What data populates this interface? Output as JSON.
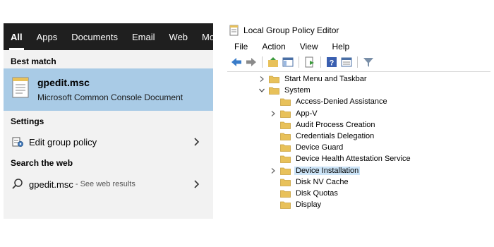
{
  "search": {
    "tabs": [
      {
        "label": "All",
        "active": true
      },
      {
        "label": "Apps"
      },
      {
        "label": "Documents"
      },
      {
        "label": "Email"
      },
      {
        "label": "Web"
      },
      {
        "label": "More"
      }
    ],
    "best_match_heading": "Best match",
    "best_match": {
      "title": "gpedit.msc",
      "subtitle": "Microsoft Common Console Document"
    },
    "settings_heading": "Settings",
    "settings_item": {
      "label": "Edit group policy"
    },
    "web_heading": "Search the web",
    "web_item": {
      "label": "gpedit.msc",
      "hint": " - See web results"
    }
  },
  "gpe": {
    "title": "Local Group Policy Editor",
    "menu": [
      "File",
      "Action",
      "View",
      "Help"
    ],
    "tree": [
      {
        "label": "Start Menu and Taskbar",
        "expander": "collapsed",
        "level": 0
      },
      {
        "label": "System",
        "expander": "expanded",
        "level": 0
      },
      {
        "label": "Access-Denied Assistance",
        "expander": "none",
        "level": 1
      },
      {
        "label": "App-V",
        "expander": "collapsed",
        "level": 1
      },
      {
        "label": "Audit Process Creation",
        "expander": "none",
        "level": 1
      },
      {
        "label": "Credentials Delegation",
        "expander": "none",
        "level": 1
      },
      {
        "label": "Device Guard",
        "expander": "none",
        "level": 1
      },
      {
        "label": "Device Health Attestation Service",
        "expander": "none",
        "level": 1
      },
      {
        "label": "Device Installation",
        "expander": "collapsed",
        "level": 1,
        "selected": true
      },
      {
        "label": "Disk NV Cache",
        "expander": "none",
        "level": 1
      },
      {
        "label": "Disk Quotas",
        "expander": "none",
        "level": 1
      },
      {
        "label": "Display",
        "expander": "none",
        "level": 1
      }
    ]
  },
  "colors": {
    "accent_selected": "#a9cbe6",
    "tree_selected": "#cce4f7",
    "folder": "#e8c15a",
    "tabs_bg": "#1f1f1f"
  }
}
